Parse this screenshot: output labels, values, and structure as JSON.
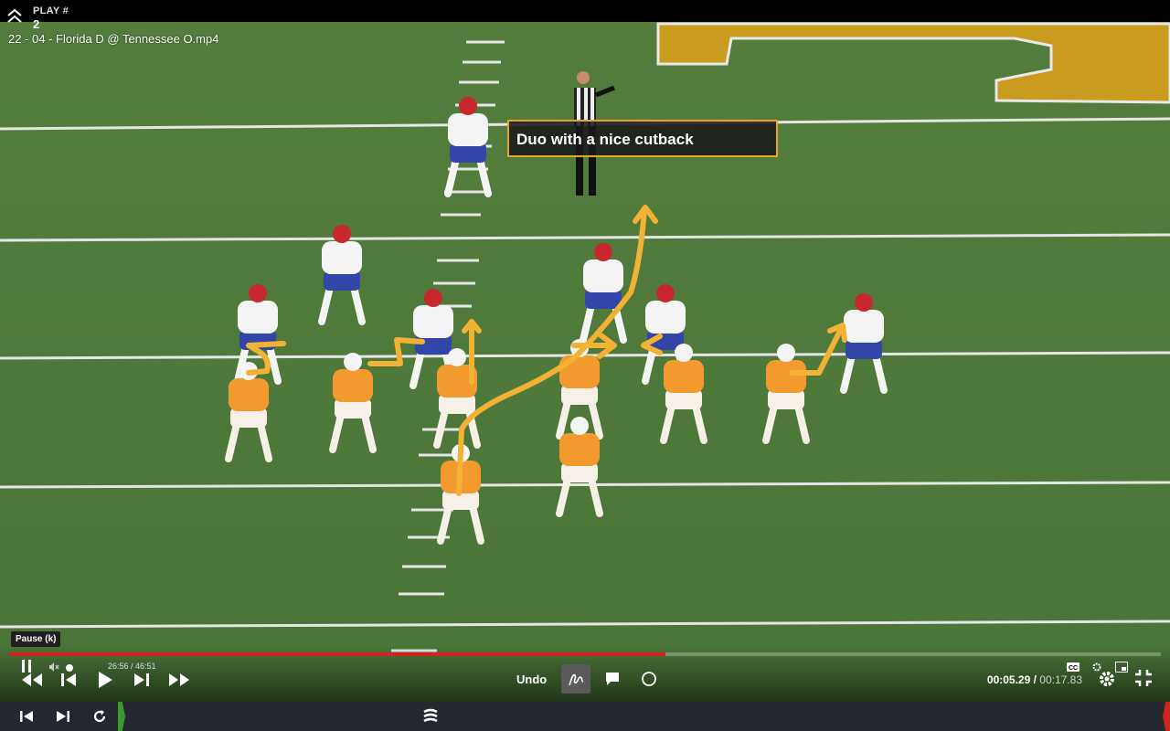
{
  "header": {
    "play_label": "PLAY #",
    "play_number": "2",
    "video_title": "22 - 04 - Florida D @ Tennessee O.mp4"
  },
  "annotation": {
    "text": "Duo with a nice cutback",
    "border_color": "#e3a32d"
  },
  "player": {
    "tooltip": "Pause (k)",
    "progress_fraction": 0.57,
    "mini_time": "26:56 / 46:51",
    "current_time": "00:05.29",
    "separator": " / ",
    "total_time": "00:17.83",
    "undo_label": "Undo",
    "accent_color": "#d32020",
    "icons": {
      "pause": "pause-icon",
      "mute": "muted-speaker-icon",
      "rewind": "rewind-icon",
      "step_back": "step-back-icon",
      "play": "play-icon",
      "step_forward": "step-forward-icon",
      "fast_forward": "fast-forward-icon",
      "draw": "freehand-draw-icon",
      "comment": "comment-icon",
      "circle": "circle-tool-icon",
      "captions": "cc-icon",
      "settings": "gear-icon",
      "pip": "picture-in-picture-icon",
      "fullscreen": "exit-fullscreen-icon"
    }
  },
  "bottom_bar": {
    "icons": {
      "prev": "skip-to-start-icon",
      "next": "skip-to-end-icon",
      "refresh": "refresh-icon",
      "logo": "hudl-logo-icon"
    },
    "start_marker_color": "#3a9b2c",
    "end_marker_color": "#c8261f"
  },
  "field": {
    "grass_color": "#4f7a3a",
    "endzone_color": "#c99b1f",
    "draw_color": "#f2b233"
  }
}
